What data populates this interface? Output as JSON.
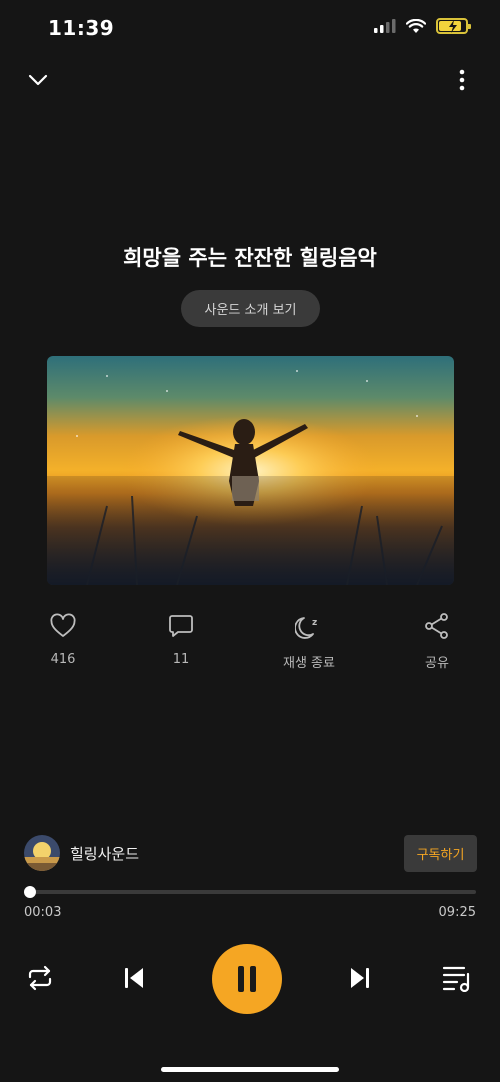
{
  "status_bar": {
    "time": "11:39"
  },
  "track": {
    "title": "희망을 주는 잔잔한 힐링음악",
    "intro_button": "사운드 소개 보기"
  },
  "actions": {
    "like_count": "416",
    "comment_count": "11",
    "sleep_label": "재생 종료",
    "share_label": "공유"
  },
  "channel": {
    "name": "힐링사운드",
    "subscribe_label": "구독하기"
  },
  "player": {
    "current_time": "00:03",
    "total_time": "09:25",
    "progress_fraction": 0.005,
    "battery_level": 0.85
  },
  "colors": {
    "accent": "#f5a623",
    "background": "#151515"
  }
}
